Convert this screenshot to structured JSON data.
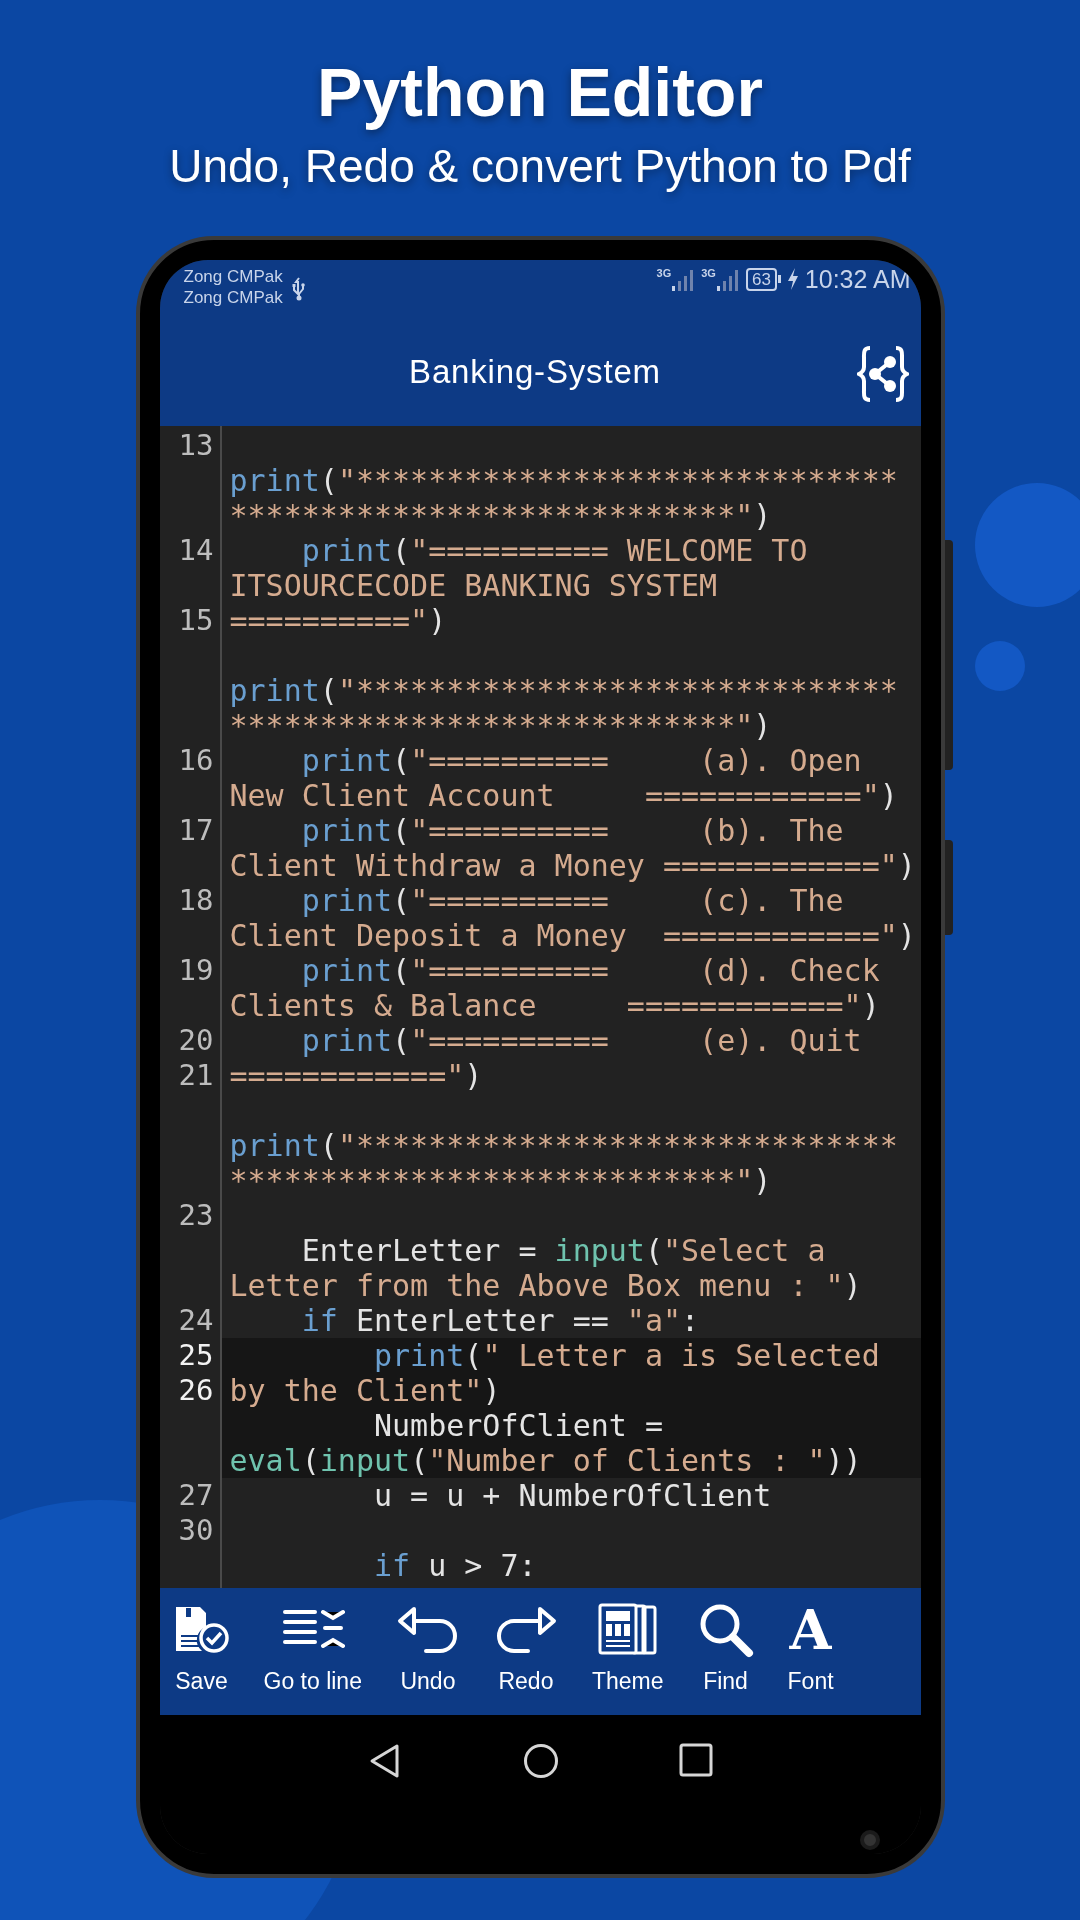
{
  "promo": {
    "title": "Python Editor",
    "subtitle": "Undo, Redo & convert Python to Pdf"
  },
  "status_bar": {
    "carriers": [
      "Zong CMPak",
      "Zong CMPak"
    ],
    "networks": [
      "3G",
      "3G"
    ],
    "battery": "63",
    "time": "10:32 AM"
  },
  "app_bar": {
    "title": "Banking-System"
  },
  "editor": {
    "rows": [
      {
        "number": "13",
        "highlighted": false,
        "tokens": []
      },
      {
        "highlighted": false,
        "tokens": [
          {
            "kind": "kw",
            "text": "print"
          },
          {
            "kind": "plain",
            "text": "("
          },
          {
            "kind": "str",
            "text": "\"******************************"
          }
        ]
      },
      {
        "highlighted": false,
        "tokens": [
          {
            "kind": "str",
            "text": "****************************\""
          },
          {
            "kind": "plain",
            "text": ")"
          }
        ]
      },
      {
        "number": "14",
        "highlighted": false,
        "tokens": [
          {
            "kind": "kw",
            "text": "    print"
          },
          {
            "kind": "plain",
            "text": "("
          },
          {
            "kind": "str",
            "text": "\"========== WELCOME TO"
          }
        ]
      },
      {
        "highlighted": false,
        "tokens": [
          {
            "kind": "str",
            "text": "ITSOURCECODE BANKING SYSTEM"
          }
        ]
      },
      {
        "number": "15",
        "highlighted": false,
        "tokens": [
          {
            "kind": "str",
            "text": "==========\""
          },
          {
            "kind": "plain",
            "text": ")"
          }
        ]
      },
      {
        "highlighted": false,
        "tokens": []
      },
      {
        "highlighted": false,
        "tokens": [
          {
            "kind": "kw",
            "text": "print"
          },
          {
            "kind": "plain",
            "text": "("
          },
          {
            "kind": "str",
            "text": "\"******************************"
          }
        ]
      },
      {
        "highlighted": false,
        "tokens": [
          {
            "kind": "str",
            "text": "****************************\""
          },
          {
            "kind": "plain",
            "text": ")"
          }
        ]
      },
      {
        "number": "16",
        "highlighted": false,
        "tokens": [
          {
            "kind": "kw",
            "text": "    print"
          },
          {
            "kind": "plain",
            "text": "("
          },
          {
            "kind": "str",
            "text": "\"==========     (a). Open"
          }
        ]
      },
      {
        "highlighted": false,
        "tokens": [
          {
            "kind": "str",
            "text": "New Client Account     ============\""
          },
          {
            "kind": "plain",
            "text": ")"
          }
        ]
      },
      {
        "number": "17",
        "highlighted": false,
        "tokens": [
          {
            "kind": "kw",
            "text": "    print"
          },
          {
            "kind": "plain",
            "text": "("
          },
          {
            "kind": "str",
            "text": "\"==========     (b). The"
          }
        ]
      },
      {
        "highlighted": false,
        "tokens": [
          {
            "kind": "str",
            "text": "Client Withdraw a Money ============\""
          },
          {
            "kind": "plain",
            "text": ")"
          }
        ]
      },
      {
        "number": "18",
        "highlighted": false,
        "tokens": [
          {
            "kind": "kw",
            "text": "    print"
          },
          {
            "kind": "plain",
            "text": "("
          },
          {
            "kind": "str",
            "text": "\"==========     (c). The"
          }
        ]
      },
      {
        "highlighted": false,
        "tokens": [
          {
            "kind": "str",
            "text": "Client Deposit a Money  ============\""
          },
          {
            "kind": "plain",
            "text": ")"
          }
        ]
      },
      {
        "number": "19",
        "highlighted": false,
        "tokens": [
          {
            "kind": "kw",
            "text": "    print"
          },
          {
            "kind": "plain",
            "text": "("
          },
          {
            "kind": "str",
            "text": "\"==========     (d). Check"
          }
        ]
      },
      {
        "highlighted": false,
        "tokens": [
          {
            "kind": "str",
            "text": "Clients & Balance     ============\""
          },
          {
            "kind": "plain",
            "text": ")"
          }
        ]
      },
      {
        "number": "20",
        "highlighted": false,
        "tokens": [
          {
            "kind": "kw",
            "text": "    print"
          },
          {
            "kind": "plain",
            "text": "("
          },
          {
            "kind": "str",
            "text": "\"==========     (e). Quit"
          }
        ]
      },
      {
        "number": "21",
        "highlighted": false,
        "tokens": [
          {
            "kind": "str",
            "text": "============\""
          },
          {
            "kind": "plain",
            "text": ")"
          }
        ]
      },
      {
        "highlighted": false,
        "tokens": []
      },
      {
        "highlighted": false,
        "tokens": [
          {
            "kind": "kw",
            "text": "print"
          },
          {
            "kind": "plain",
            "text": "("
          },
          {
            "kind": "str",
            "text": "\"******************************"
          }
        ]
      },
      {
        "highlighted": false,
        "tokens": [
          {
            "kind": "str",
            "text": "****************************\""
          },
          {
            "kind": "plain",
            "text": ")"
          }
        ]
      },
      {
        "number": "23",
        "highlighted": false,
        "tokens": []
      },
      {
        "highlighted": false,
        "tokens": [
          {
            "kind": "plain",
            "text": "    EnterLetter = "
          },
          {
            "kind": "fn",
            "text": "input"
          },
          {
            "kind": "plain",
            "text": "("
          },
          {
            "kind": "str",
            "text": "\"Select a"
          }
        ]
      },
      {
        "highlighted": false,
        "tokens": [
          {
            "kind": "str",
            "text": "Letter from the Above Box menu : \""
          },
          {
            "kind": "plain",
            "text": ")"
          }
        ]
      },
      {
        "number": "24",
        "highlighted": false,
        "tokens": [
          {
            "kind": "kw",
            "text": "    if"
          },
          {
            "kind": "plain",
            "text": " EnterLetter == "
          },
          {
            "kind": "str",
            "text": "\"a\""
          },
          {
            "kind": "plain",
            "text": ":"
          }
        ]
      },
      {
        "number": "25",
        "highlighted": true,
        "tokens": [
          {
            "kind": "kw",
            "text": "        print"
          },
          {
            "kind": "plain",
            "text": "("
          },
          {
            "kind": "str",
            "text": "\" Letter a is Selected"
          }
        ]
      },
      {
        "number": "26",
        "highlighted": true,
        "tokens": [
          {
            "kind": "str",
            "text": "by the Client\""
          },
          {
            "kind": "plain",
            "text": ")"
          }
        ]
      },
      {
        "highlighted": true,
        "tokens": [
          {
            "kind": "plain",
            "text": "        NumberOfClient ="
          }
        ]
      },
      {
        "highlighted": true,
        "tokens": [
          {
            "kind": "fn",
            "text": "eval"
          },
          {
            "kind": "plain",
            "text": "("
          },
          {
            "kind": "fn",
            "text": "input"
          },
          {
            "kind": "plain",
            "text": "("
          },
          {
            "kind": "str",
            "text": "\"Number of Clients : \""
          },
          {
            "kind": "plain",
            "text": "))"
          }
        ]
      },
      {
        "number": "27",
        "highlighted": false,
        "tokens": [
          {
            "kind": "plain",
            "text": "        u = u + NumberOfClient"
          }
        ]
      },
      {
        "number": "30",
        "highlighted": false,
        "tokens": []
      },
      {
        "highlighted": false,
        "tokens": [
          {
            "kind": "kw",
            "text": "        if"
          },
          {
            "kind": "plain",
            "text": " u > 7:"
          }
        ]
      }
    ]
  },
  "toolbar": [
    {
      "kind": "save",
      "label": "Save"
    },
    {
      "kind": "goto",
      "label": "Go to line"
    },
    {
      "kind": "undo",
      "label": "Undo"
    },
    {
      "kind": "redo",
      "label": "Redo"
    },
    {
      "kind": "theme",
      "label": "Theme"
    },
    {
      "kind": "find",
      "label": "Find"
    },
    {
      "kind": "font",
      "label": "Font",
      "glyph": "A"
    }
  ]
}
